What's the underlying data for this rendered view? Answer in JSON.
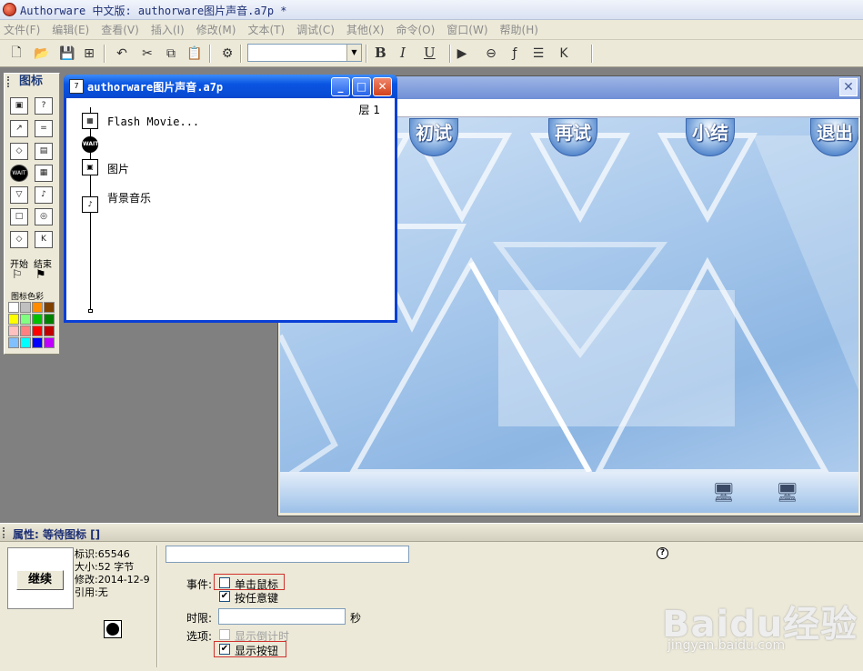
{
  "window": {
    "title": "Authorware 中文版: authorware图片声音.a7p *"
  },
  "menu": [
    "文件(F)",
    "编辑(E)",
    "查看(V)",
    "插入(I)",
    "修改(M)",
    "文本(T)",
    "调试(C)",
    "其他(X)",
    "命令(O)",
    "窗口(W)",
    "帮助(H)"
  ],
  "toolbar": {
    "bold": "B",
    "italic": "I",
    "underline": "U",
    "font_value": ""
  },
  "palette": {
    "title": "图标",
    "start_label": "开始",
    "end_label": "结束",
    "colors_label": "图标色彩",
    "colors": [
      "#ffffff",
      "#c0c0c0",
      "#ff8c00",
      "#804000",
      "#ffff00",
      "#80ff80",
      "#00c000",
      "#008000",
      "#ffc0c0",
      "#ff8080",
      "#ff0000",
      "#c00000",
      "#80c0ff",
      "#00ffff",
      "#0000ff",
      "#c000ff"
    ]
  },
  "flowline": {
    "title": "authorware图片声音.a7p",
    "layer": "层 1",
    "items": [
      {
        "label": "Flash Movie...",
        "icon": "flash-movie-icon"
      },
      {
        "label": "",
        "icon": "wait-icon"
      },
      {
        "label": "图片",
        "icon": "display-icon"
      },
      {
        "label": "背景音乐",
        "icon": "sound-icon"
      }
    ]
  },
  "stage": {
    "buttons": [
      "初试",
      "再试",
      "小结",
      "退出"
    ]
  },
  "properties": {
    "header": "属性: 等待图标 []",
    "preview_button": "继续",
    "id_line": "标识:65546",
    "size_line": "大小:52 字节",
    "modified_line": "修改:2014-12-9",
    "ref_line": "引用:无",
    "events_label": "事件:",
    "click_mouse": "单击鼠标",
    "any_key": "按任意键",
    "time_label": "时限:",
    "seconds": "秒",
    "options_label": "选项:",
    "show_countdown": "显示倒计时",
    "show_button": "显示按钮",
    "help": "?",
    "click_mouse_checked": false,
    "any_key_checked": true,
    "show_countdown_checked": false,
    "show_button_checked": true
  },
  "watermark": {
    "text": "Baidu经验",
    "url": "jingyan.baidu.com"
  }
}
